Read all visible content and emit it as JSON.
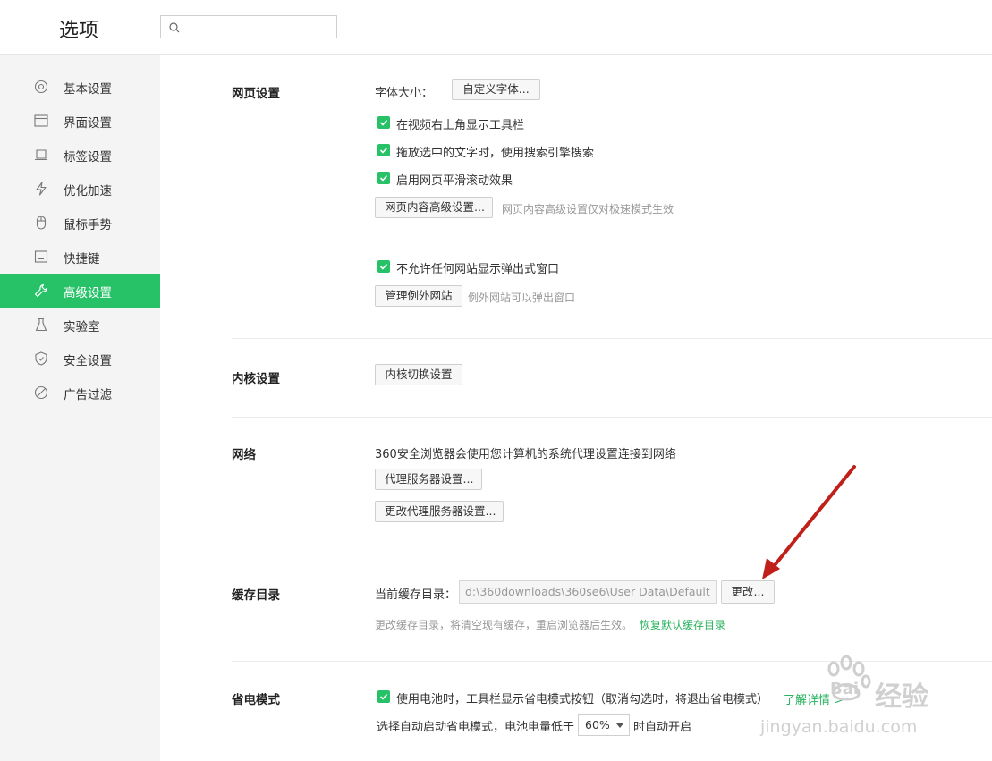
{
  "header": {
    "title": "选项",
    "search_placeholder": ""
  },
  "sidebar": {
    "items": [
      {
        "label": "基本设置",
        "icon": "gear-icon"
      },
      {
        "label": "界面设置",
        "icon": "window-icon"
      },
      {
        "label": "标签设置",
        "icon": "tab-icon"
      },
      {
        "label": "优化加速",
        "icon": "lightning-icon"
      },
      {
        "label": "鼠标手势",
        "icon": "mouse-icon"
      },
      {
        "label": "快捷键",
        "icon": "keyboard-icon"
      },
      {
        "label": "高级设置",
        "icon": "wrench-icon",
        "active": true
      },
      {
        "label": "实验室",
        "icon": "flask-icon"
      },
      {
        "label": "安全设置",
        "icon": "shield-icon"
      },
      {
        "label": "广告过滤",
        "icon": "block-icon"
      }
    ]
  },
  "webpage": {
    "title": "网页设置",
    "font_size_label": "字体大小：",
    "custom_font_button": "自定义字体...",
    "opt_toolbar": "在视频右上角显示工具栏",
    "opt_drag_search": "拖放选中的文字时，使用搜索引擎搜索",
    "opt_smooth_scroll": "启用网页平滑滚动效果",
    "advanced_content_button": "网页内容高级设置...",
    "advanced_content_hint": "网页内容高级设置仅对极速模式生效",
    "opt_block_popups": "不允许任何网站显示弹出式窗口",
    "manage_exceptions_button": "管理例外网站",
    "manage_exceptions_hint": "例外网站可以弹出窗口"
  },
  "kernel": {
    "title": "内核设置",
    "switch_button": "内核切换设置"
  },
  "network": {
    "title": "网络",
    "desc": "360安全浏览器会使用您计算机的系统代理设置连接到网络",
    "proxy_button": "代理服务器设置...",
    "change_proxy_button": "更改代理服务器设置..."
  },
  "cache": {
    "title": "缓存目录",
    "current_label": "当前缓存目录：",
    "path": "d:\\360downloads\\360se6\\User Data\\Default",
    "change_button": "更改...",
    "hint": "更改缓存目录，将清空现有缓存，重启浏览器后生效。",
    "restore_link": "恢复默认缓存目录"
  },
  "power": {
    "title": "省电模式",
    "opt_battery": "使用电池时，工具栏显示省电模式按钮（取消勾选时，将退出省电模式）",
    "learn_more_link": "了解详情 >",
    "auto_label": "选择自动启动省电模式，电池电量低于",
    "threshold": "60%",
    "auto_suffix": "时自动开启"
  },
  "watermark": {
    "brand": "Bai",
    "text": "经验",
    "url": "jingyan.baidu.com"
  },
  "colors": {
    "accent": "#27c267",
    "arrow": "#c0201a"
  }
}
